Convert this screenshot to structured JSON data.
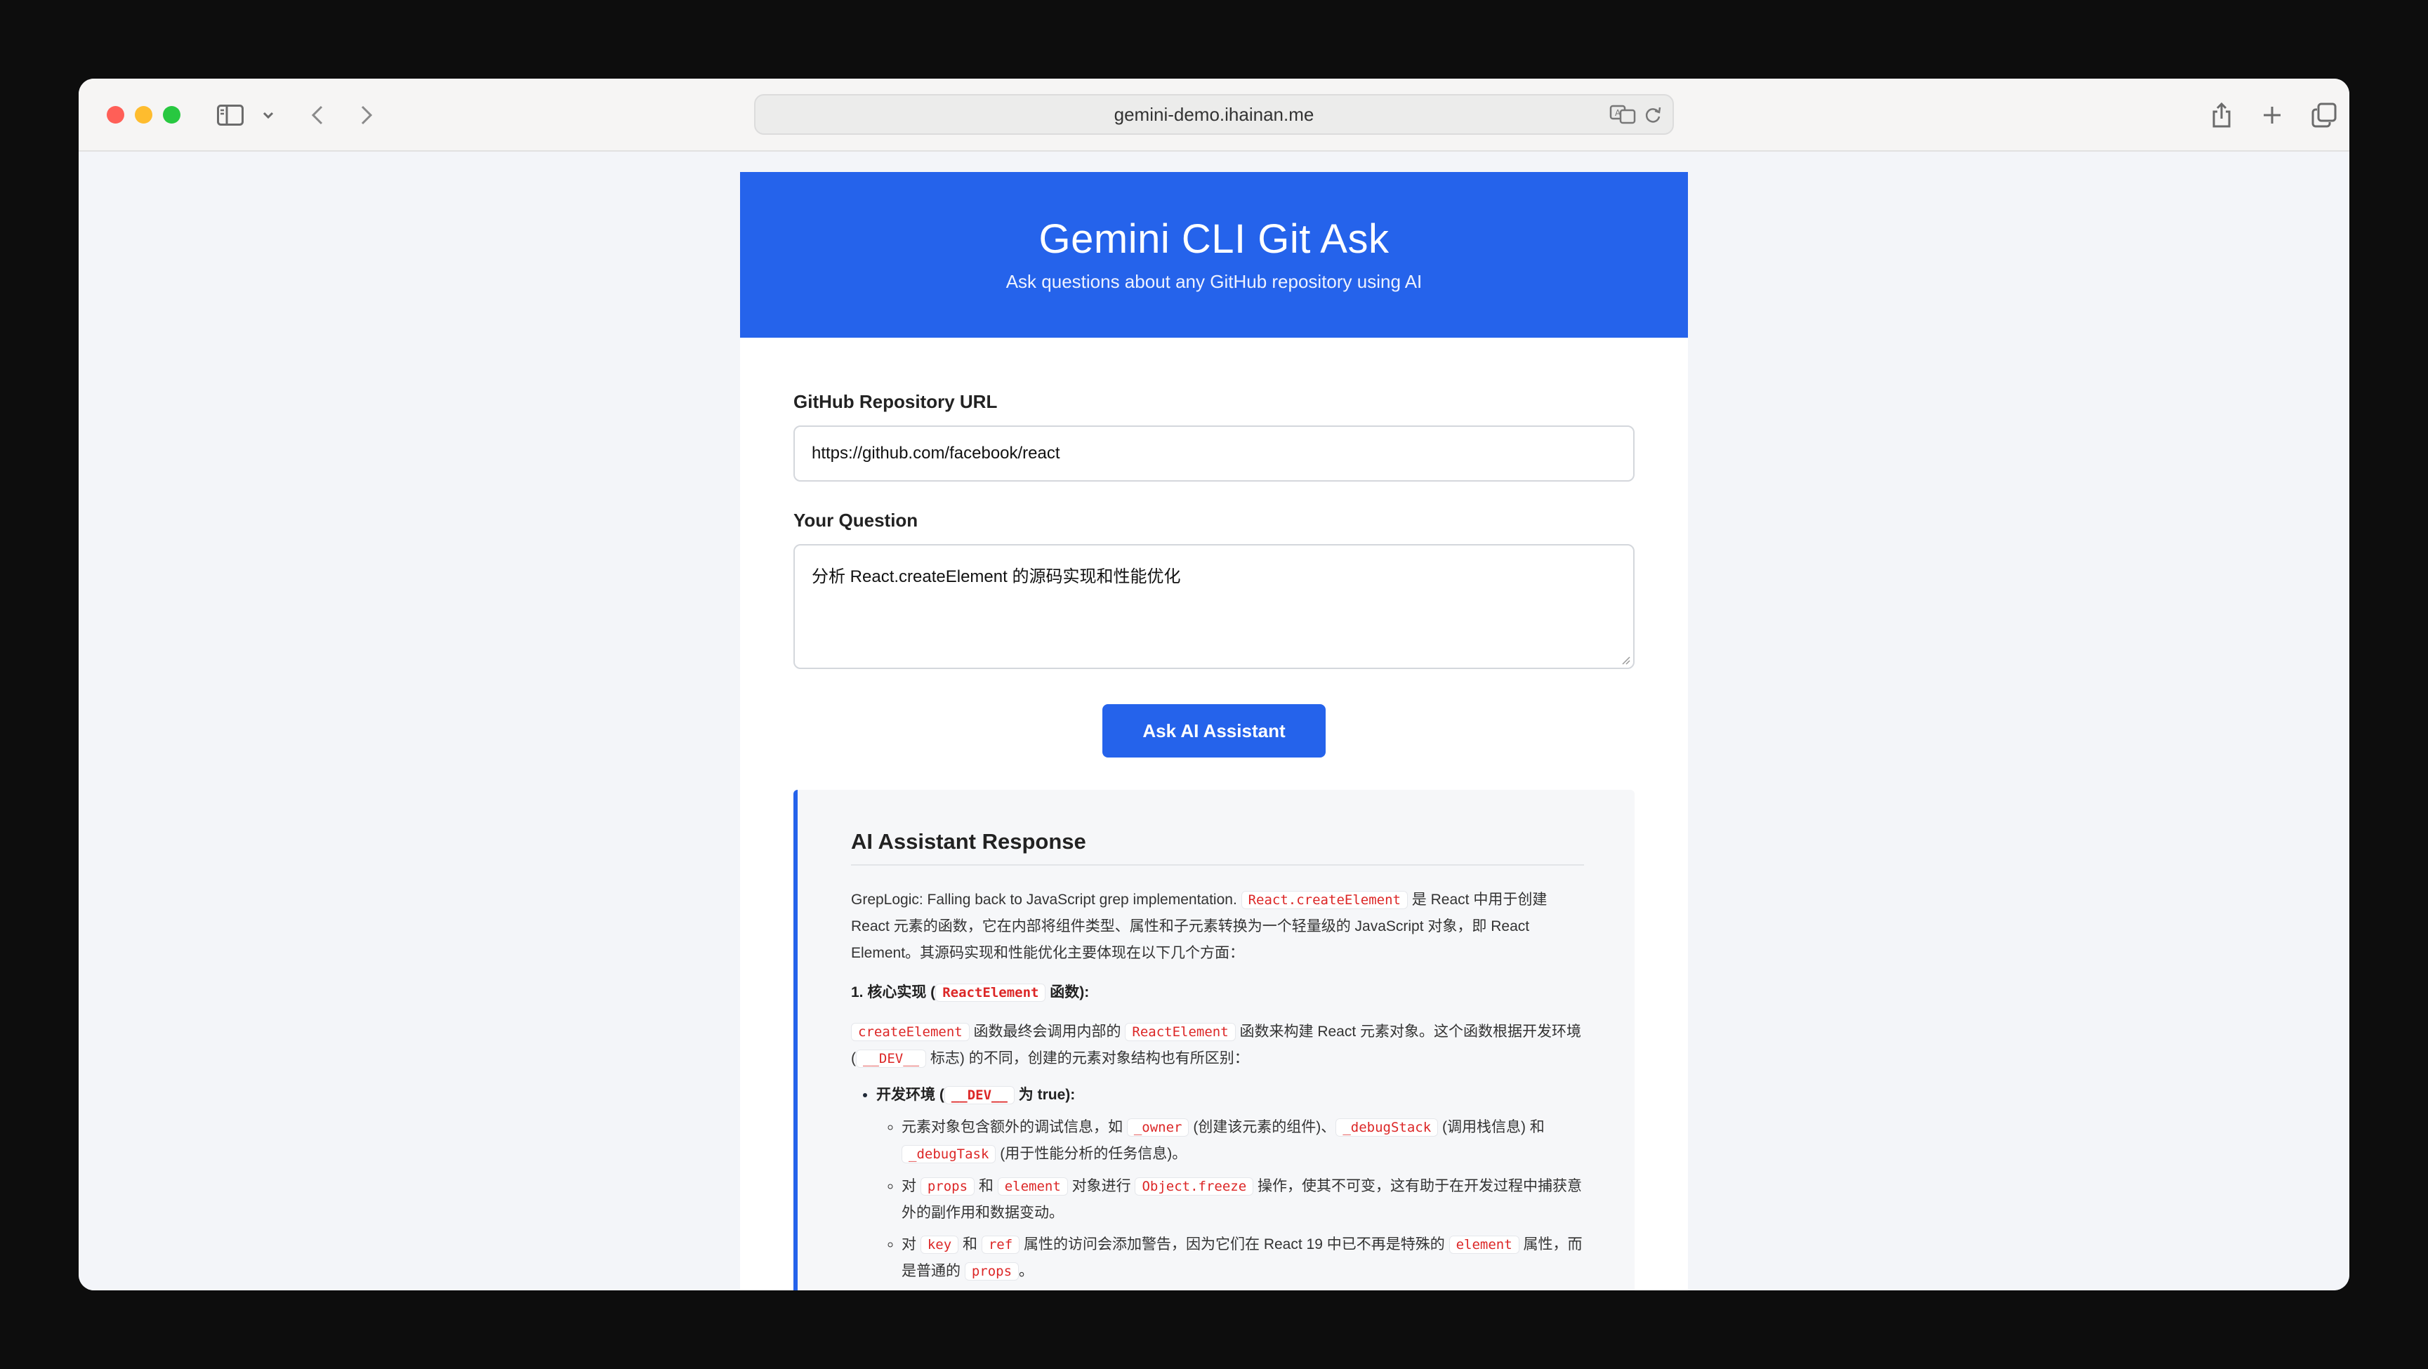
{
  "browser": {
    "url": "gemini-demo.ihainan.me"
  },
  "app": {
    "title": "Gemini CLI Git Ask",
    "subtitle": "Ask questions about any GitHub repository using AI"
  },
  "form": {
    "repo_label": "GitHub Repository URL",
    "repo_value": "https://github.com/facebook/react",
    "question_label": "Your Question",
    "question_value": "分析 React.createElement 的源码实现和性能优化",
    "submit_label": "Ask AI Assistant"
  },
  "response": {
    "heading": "AI Assistant Response",
    "intro": {
      "a": "GrepLogic: Falling back to JavaScript grep implementation. ",
      "code1": "React.createElement",
      "b": " 是 React 中用于创建 React 元素的函数，它在内部将组件类型、属性和子元素转换为一个轻量级的 JavaScript 对象，即 React Element。其源码实现和性能优化主要体现在以下几个方面："
    },
    "section1": {
      "a": "1. 核心实现 (",
      "code": "ReactElement",
      "b": " 函数):"
    },
    "para2": {
      "code1": "createElement",
      "a": " 函数最终会调用内部的 ",
      "code2": "ReactElement",
      "b": " 函数来构建 React 元素对象。这个函数根据开发环境 (",
      "code3": "__DEV__",
      "c": " 标志) 的不同，创建的元素对象结构也有所区别："
    },
    "bullet1": {
      "a": "开发环境 (",
      "code": "__DEV__",
      "b": " 为 true):"
    },
    "sub1": {
      "a": "元素对象包含额外的调试信息，如 ",
      "code1": "_owner",
      "b": " (创建该元素的组件)、",
      "code2": "_debugStack",
      "c": " (调用栈信息) 和 ",
      "code3": "_debugTask",
      "d": " (用于性能分析的任务信息)。"
    },
    "sub2": {
      "a": "对 ",
      "code1": "props",
      "b": " 和 ",
      "code2": "element",
      "c": " 对象进行 ",
      "code3": "Object.freeze",
      "d": " 操作，使其不可变，这有助于在开发过程中捕获意外的副作用和数据变动。"
    },
    "sub3": {
      "a": "对 ",
      "code1": "key",
      "b": " 和 ",
      "code2": "ref",
      "c": " 属性的访问会添加警告，因为它们在 React 19 中已不再是特殊的 ",
      "code3": "element",
      "d": " 属性，而是普通的 ",
      "code4": "props",
      "e": "。"
    }
  },
  "colors": {
    "accent": "#2563eb",
    "code_text": "#dc2626"
  },
  "icons": [
    "sidebar-icon",
    "chevron-down-icon",
    "back-icon",
    "forward-icon",
    "translate-icon",
    "reload-icon",
    "share-icon",
    "plus-icon",
    "tabs-icon"
  ]
}
